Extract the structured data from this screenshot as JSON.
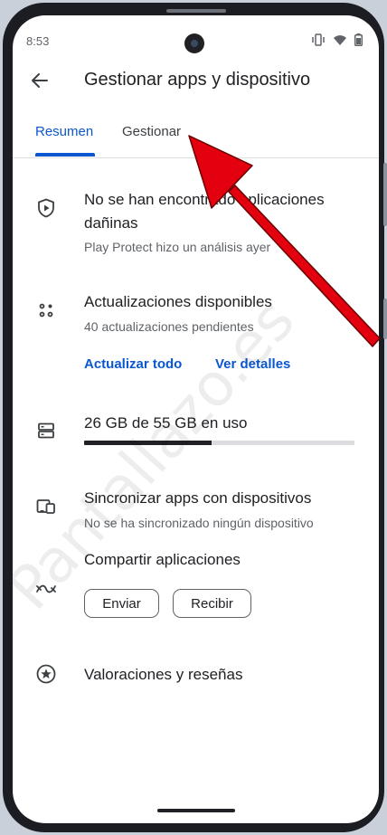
{
  "status_bar": {
    "time": "8:53",
    "icons": [
      "vibrate-icon",
      "wifi-icon",
      "battery-icon"
    ]
  },
  "app_bar": {
    "title": "Gestionar apps y dispositivo",
    "back_icon": "back-arrow-icon"
  },
  "tabs": [
    {
      "label": "Resumen",
      "active": true
    },
    {
      "label": "Gestionar",
      "active": false
    }
  ],
  "protect": {
    "title": "No se han encontrado aplicaciones dañinas",
    "subtitle": "Play Protect hizo un análisis ayer",
    "icon": "shield-play-icon"
  },
  "updates": {
    "title": "Actualizaciones disponibles",
    "subtitle": "40 actualizaciones pendientes",
    "icon": "apps-dots-icon",
    "update_all_label": "Actualizar todo",
    "details_label": "Ver detalles"
  },
  "storage": {
    "title": "26 GB de 55 GB en uso",
    "used_fraction": 0.47,
    "icon": "storage-icon"
  },
  "sync": {
    "title": "Sincronizar apps con dispositivos",
    "subtitle": "No se ha sincronizado ningún dispositivo",
    "icon": "devices-icon"
  },
  "share": {
    "title": "Compartir aplicaciones",
    "send_label": "Enviar",
    "receive_label": "Recibir",
    "icon": "share-swap-icon"
  },
  "ratings": {
    "title": "Valoraciones y reseñas",
    "icon": "star-circle-icon"
  },
  "watermark": "Pantallazo.es",
  "colors": {
    "accent": "#0b57d0",
    "annotation_arrow": "#e3000f"
  }
}
